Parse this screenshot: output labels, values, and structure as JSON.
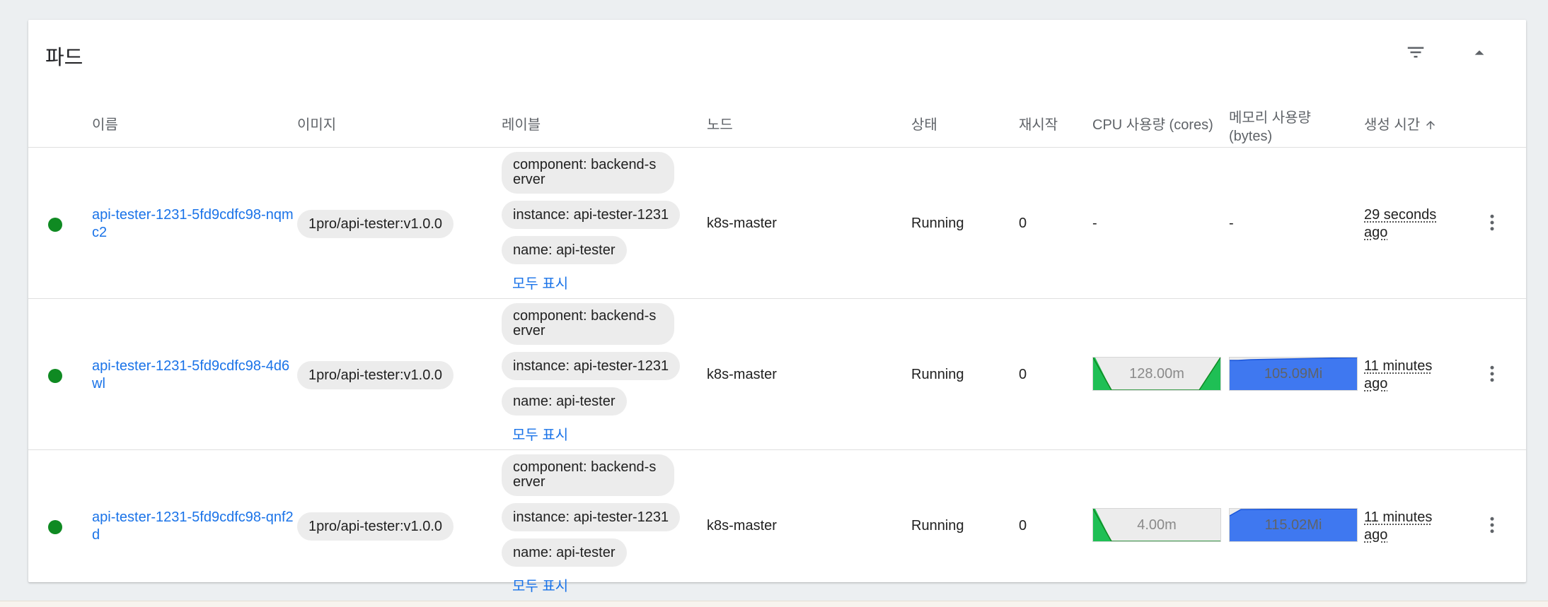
{
  "card": {
    "title": "파드"
  },
  "icons": {
    "filter": "filter-list-icon",
    "collapse": "expand-less-icon",
    "more": "more-vert-icon",
    "sort": "arrow-upward-icon"
  },
  "colors": {
    "link": "#1a73e8",
    "status_running": "#0f8a22",
    "cpu_fill": "#1fbf55",
    "mem_fill": "#3f78f0"
  },
  "columns": {
    "name": "이름",
    "image": "이미지",
    "labels": "레이블",
    "node": "노드",
    "status": "상태",
    "restarts": "재시작",
    "cpu": "CPU 사용량 (cores)",
    "memory_line1": "메모리 사용량",
    "memory_line2": "(bytes)",
    "created": "생성 시간"
  },
  "pods": [
    {
      "name": "api-tester-1231-5fd9cdfc98-nqmc2",
      "image": "1pro/api-tester:v1.0.0",
      "labels": [
        "component: backend-server",
        "instance: api-tester-1231",
        "name: api-tester"
      ],
      "show_all": "모두 표시",
      "node": "k8s-master",
      "status": "Running",
      "restarts": "0",
      "cpu": "-",
      "memory": "-",
      "created": "29 seconds ago"
    },
    {
      "name": "api-tester-1231-5fd9cdfc98-4d6wl",
      "image": "1pro/api-tester:v1.0.0",
      "labels": [
        "component: backend-server",
        "instance: api-tester-1231",
        "name: api-tester"
      ],
      "show_all": "모두 표시",
      "node": "k8s-master",
      "status": "Running",
      "restarts": "0",
      "cpu": "128.00m",
      "memory": "105.09Mi",
      "created": "11 minutes ago"
    },
    {
      "name": "api-tester-1231-5fd9cdfc98-qnf2d",
      "image": "1pro/api-tester:v1.0.0",
      "labels": [
        "component: backend-server",
        "instance: api-tester-1231",
        "name: api-tester"
      ],
      "show_all": "모두 표시",
      "node": "k8s-master",
      "status": "Running",
      "restarts": "0",
      "cpu": "4.00m",
      "memory": "115.02Mi",
      "created": "11 minutes ago"
    }
  ]
}
